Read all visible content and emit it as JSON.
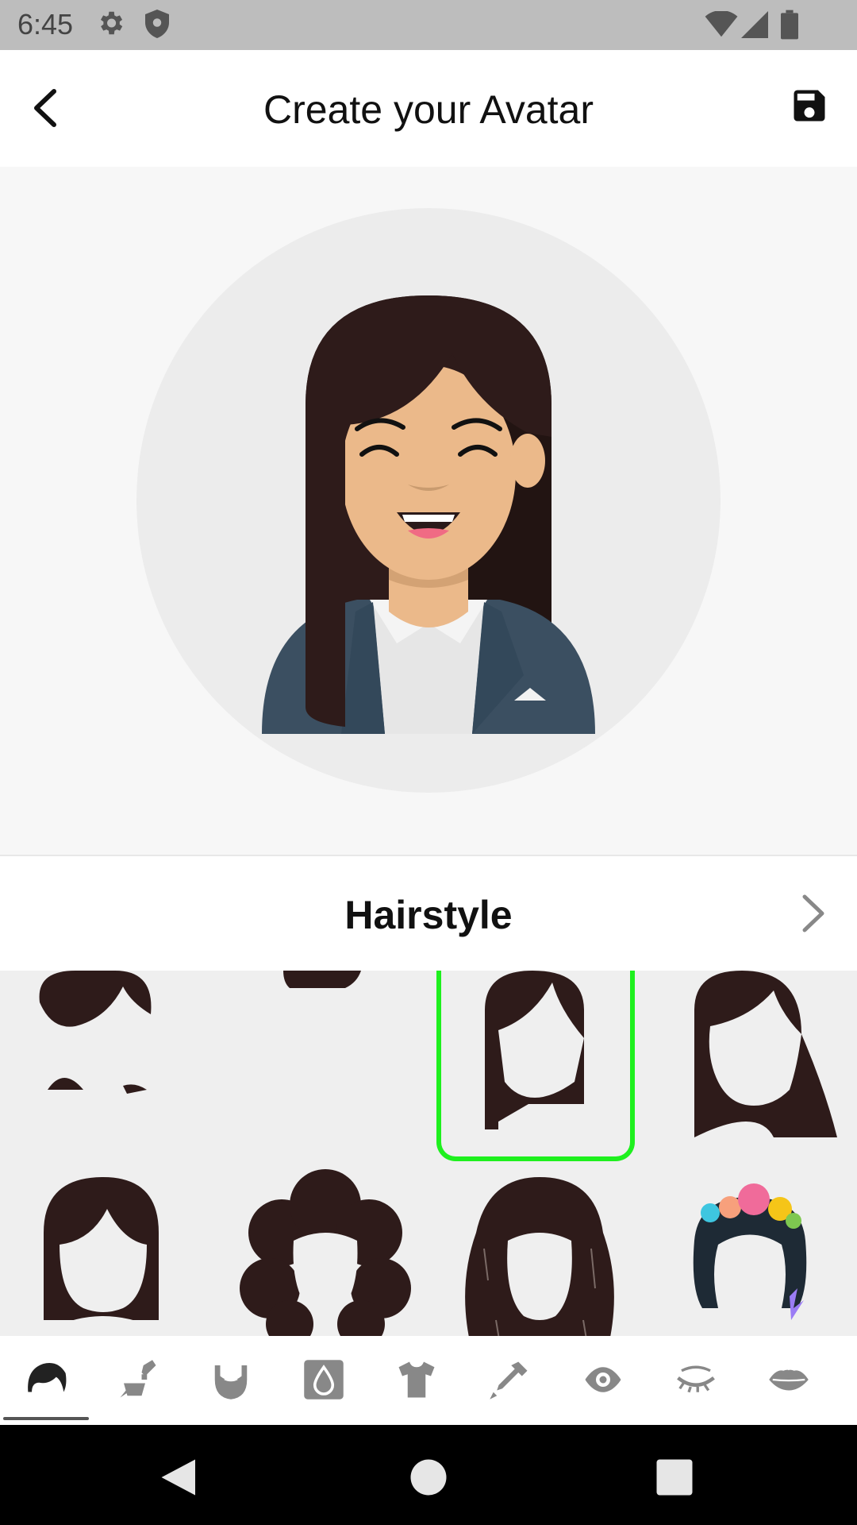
{
  "status_bar": {
    "time": "6:45",
    "icons": [
      "gear-icon",
      "shield-icon",
      "wifi-icon",
      "signal-icon",
      "battery-icon"
    ]
  },
  "header": {
    "title": "Create your Avatar",
    "back_icon": "back-arrow-icon",
    "save_icon": "save-icon"
  },
  "section": {
    "title": "Hairstyle",
    "next_icon": "chevron-right-icon"
  },
  "hairstyles": [
    {
      "name": "short-bangs",
      "selected": false
    },
    {
      "name": "buzz",
      "selected": false
    },
    {
      "name": "long-straight",
      "selected": true
    },
    {
      "name": "long-side-part",
      "selected": false
    },
    {
      "name": "bob",
      "selected": false
    },
    {
      "name": "curly-afro",
      "selected": false
    },
    {
      "name": "long-wavy",
      "selected": false
    },
    {
      "name": "flower-crown",
      "selected": false
    }
  ],
  "tabs": [
    {
      "name": "hair-icon",
      "active": true
    },
    {
      "name": "hair-color-icon",
      "active": false
    },
    {
      "name": "beard-icon",
      "active": false
    },
    {
      "name": "skin-tone-icon",
      "active": false
    },
    {
      "name": "shirt-icon",
      "active": false
    },
    {
      "name": "clothing-color-icon",
      "active": false
    },
    {
      "name": "eye-icon",
      "active": false
    },
    {
      "name": "eyelash-icon",
      "active": false
    },
    {
      "name": "lips-icon",
      "active": false
    }
  ],
  "colors": {
    "hair": "#2e1b1a",
    "skin": "#ebb98a",
    "jacket": "#3b4f61",
    "selection": "#1ef01e",
    "preview_circle": "#ececec"
  },
  "nav_bar": [
    "back-triangle-icon",
    "home-circle-icon",
    "recents-square-icon"
  ]
}
